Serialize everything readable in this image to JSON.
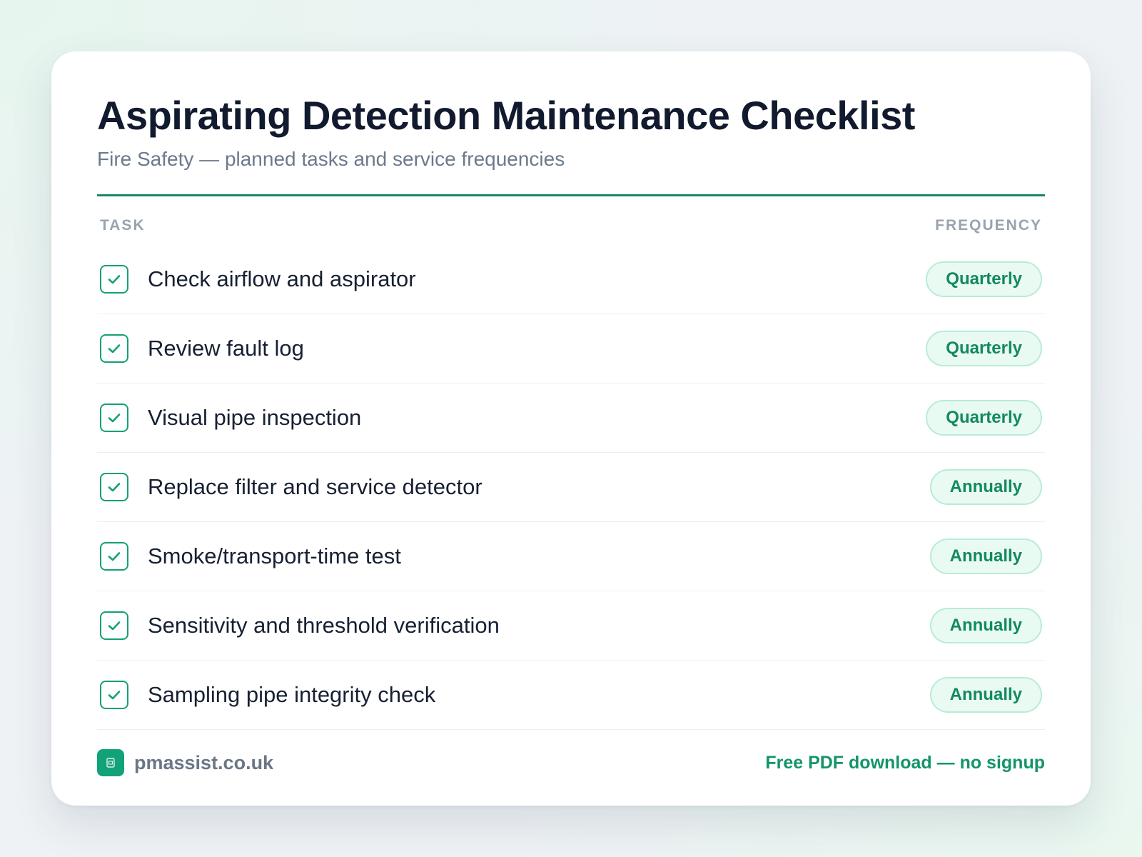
{
  "header": {
    "title": "Aspirating Detection Maintenance Checklist",
    "subtitle": "Fire Safety — planned tasks and service frequencies"
  },
  "columns": {
    "task": "TASK",
    "frequency": "FREQUENCY"
  },
  "tasks": [
    {
      "label": "Check airflow and aspirator",
      "frequency": "Quarterly",
      "checked": true
    },
    {
      "label": "Review fault log",
      "frequency": "Quarterly",
      "checked": true
    },
    {
      "label": "Visual pipe inspection",
      "frequency": "Quarterly",
      "checked": true
    },
    {
      "label": "Replace filter and service detector",
      "frequency": "Annually",
      "checked": true
    },
    {
      "label": "Smoke/transport-time test",
      "frequency": "Annually",
      "checked": true
    },
    {
      "label": "Sensitivity and threshold verification",
      "frequency": "Annually",
      "checked": true
    },
    {
      "label": "Sampling pipe integrity check",
      "frequency": "Annually",
      "checked": true
    }
  ],
  "footer": {
    "brand": "pmassist.co.uk",
    "brand_icon": "document-icon",
    "cta": "Free PDF download — no signup"
  },
  "colors": {
    "accent": "#168a62",
    "badge_bg": "#e9faf2",
    "title": "#111a2e",
    "muted": "#6b7a8c"
  }
}
